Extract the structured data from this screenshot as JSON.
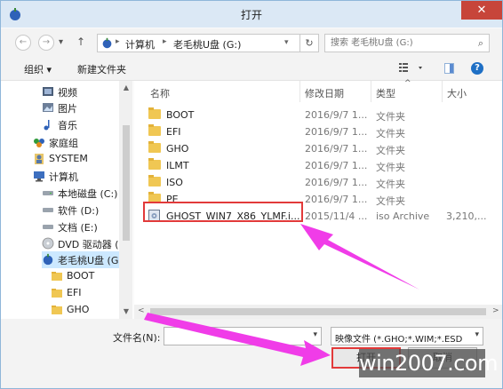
{
  "window": {
    "title": "打开",
    "close_glyph": "✕"
  },
  "address": {
    "breadcrumbs": [
      "计算机",
      "老毛桃U盘 (G:)"
    ],
    "search_placeholder": "搜索 老毛桃U盘 (G:)"
  },
  "toolbar": {
    "organize": "组织 ▾",
    "new_folder": "新建文件夹"
  },
  "nav": {
    "items": [
      {
        "label": "视频",
        "icon": "video-icon"
      },
      {
        "label": "图片",
        "icon": "picture-icon"
      },
      {
        "label": "音乐",
        "icon": "music-icon"
      },
      {
        "label": "家庭组",
        "icon": "homegroup-icon"
      },
      {
        "label": "SYSTEM",
        "icon": "user-icon"
      },
      {
        "label": "计算机",
        "icon": "computer-icon"
      },
      {
        "label": "本地磁盘 (C:)",
        "icon": "drive-icon"
      },
      {
        "label": "软件 (D:)",
        "icon": "drive-icon"
      },
      {
        "label": "文档 (E:)",
        "icon": "drive-icon"
      },
      {
        "label": "DVD 驱动器 (F",
        "icon": "dvd-icon"
      },
      {
        "label": "老毛桃U盘 (G:)",
        "icon": "usb-icon"
      },
      {
        "label": "BOOT",
        "icon": "folder-icon"
      },
      {
        "label": "EFI",
        "icon": "folder-icon"
      },
      {
        "label": "GHO",
        "icon": "folder-icon"
      }
    ]
  },
  "columns": {
    "name": "名称",
    "date": "修改日期",
    "type": "类型",
    "size": "大小"
  },
  "files": [
    {
      "name": "BOOT",
      "date": "2016/9/7 1...",
      "type": "文件夹",
      "size": ""
    },
    {
      "name": "EFI",
      "date": "2016/9/7 1...",
      "type": "文件夹",
      "size": ""
    },
    {
      "name": "GHO",
      "date": "2016/9/7 1...",
      "type": "文件夹",
      "size": ""
    },
    {
      "name": "ILMT",
      "date": "2016/9/7 1...",
      "type": "文件夹",
      "size": ""
    },
    {
      "name": "ISO",
      "date": "2016/9/7 1...",
      "type": "文件夹",
      "size": ""
    },
    {
      "name": "PE",
      "date": "2016/9/7 1...",
      "type": "文件夹",
      "size": ""
    },
    {
      "name": "GHOST_WIN7_X86_YLMF.i...",
      "date": "2015/11/4 ...",
      "type": "iso Archive",
      "size": "3,210,..."
    }
  ],
  "bottom": {
    "filename_label": "文件名(N):",
    "filename_value": "",
    "filetype": "映像文件 (*.GHO;*.WIM;*.ESD",
    "open_label": "打开",
    "cancel_label": "取消"
  },
  "watermark": "win2007.com",
  "colors": {
    "accent": "#1e6fc5",
    "highlight_red": "#e23a3a",
    "arrow_magenta": "#f03ce8"
  }
}
